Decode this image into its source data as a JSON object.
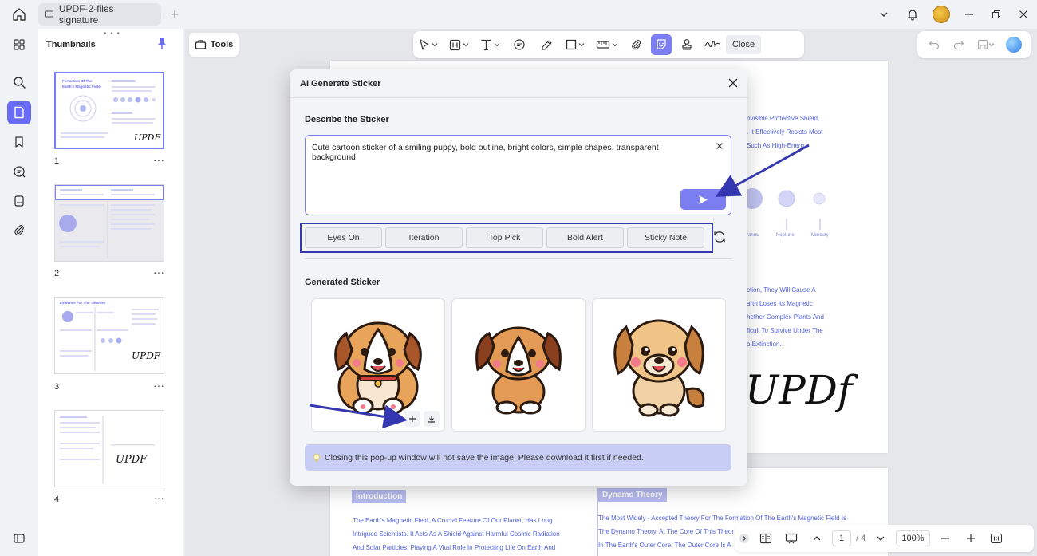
{
  "titlebar": {
    "tab_title": "UPDF-2-files signature"
  },
  "thumbnails": {
    "title": "Thumbnails",
    "pages": [
      {
        "number": "1",
        "heading": "Formation Of The Earth's Magnetic Field",
        "signature": "UPDF"
      },
      {
        "number": "2",
        "heading": "",
        "signature": ""
      },
      {
        "number": "3",
        "heading": "Evidence For The Theories",
        "signature": "UPDF"
      },
      {
        "number": "4",
        "heading": "",
        "signature": "UPDF"
      }
    ],
    "more_label": "···"
  },
  "toolbar": {
    "tools_label": "Tools",
    "close_label": "Close"
  },
  "document": {
    "page1_lines": [
      "nvisible Protective Shield,",
      ". It Effectively Resists Most",
      "Such As High-Energ"
    ],
    "planet_labels": [
      "ranus",
      "Neptune",
      "Mercury"
    ],
    "page1_lines_b": [
      "ction, They Will Cause A",
      "arth Loses Its Magnetic",
      "hether Complex Plants And",
      "ficult To Survive Under The",
      "o Extinction."
    ],
    "signature": "UPDf",
    "page2": {
      "intro_heading": "Introduction",
      "intro_lines": [
        "The Earth's Magnetic Field, A Crucial Feature Of Our Planet, Has Long",
        "Intrigued Scientists. It Acts As A Shield Against Harmful Cosmic Radiation",
        "And Solar Particles, Playing A Vital Role In Protecting Life On Earth And"
      ],
      "dynamo_heading": "Dynamo Theory",
      "dynamo_lines": [
        "The Most Widely - Accepted Theory For The Formation Of The Earth's Magnetic Field Is",
        "The Dynamo Theory. At The Core Of This Theor",
        "In The Earth's Outer Core. The Outer Core Is A"
      ]
    }
  },
  "bottombar": {
    "current_page": "1",
    "page_total": "/ 4",
    "zoom": "100%"
  },
  "modal": {
    "title": "AI Generate Sticker",
    "describe_label": "Describe the Sticker",
    "prompt_value": "Cute cartoon sticker of a smiling puppy, bold outline, bright colors, simple shapes, transparent background.",
    "chips": [
      "Eyes On",
      "Iteration",
      "Top Pick",
      "Bold Alert",
      "Sticky Note"
    ],
    "generated_label": "Generated Sticker",
    "notice": "Closing this pop-up window will not save the image. Please download it first if needed."
  },
  "colors": {
    "accent": "#7b7ef0",
    "annotation": "#3537b0",
    "doc_text": "#5060e0"
  },
  "icons": {
    "thumb_actions": [
      "plus-icon",
      "download-icon"
    ],
    "notice": "lightbulb-icon"
  }
}
